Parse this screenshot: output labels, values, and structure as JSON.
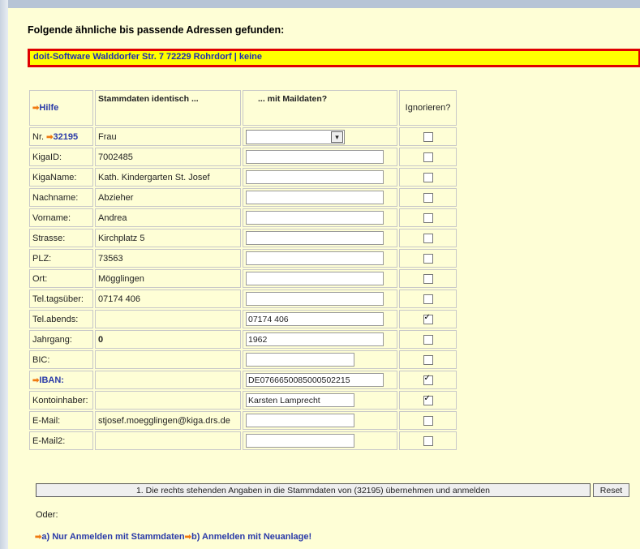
{
  "heading": "Folgende ähnliche bis passende Adressen gefunden:",
  "banner": "doit-Software Walddorfer Str. 7 72229 Rohrdorf | keine",
  "table": {
    "help_link": "Hilfe",
    "col_master": "Stammdaten identisch ...",
    "col_mail": "... mit Maildaten?",
    "col_ignore": "Ignorieren?",
    "rows": [
      {
        "label": "Nr.",
        "label_link": "32195",
        "master": "Frau",
        "mail_type": "select",
        "mail_value": "",
        "ignore": false
      },
      {
        "label": "KigaID:",
        "master": "7002485",
        "mail_type": "text",
        "mail_value": "",
        "ignore": false
      },
      {
        "label": "KigaName:",
        "master": "Kath. Kindergarten St. Josef",
        "mail_type": "text",
        "mail_value": "",
        "ignore": false
      },
      {
        "label": "Nachname:",
        "master": "Abzieher",
        "mail_type": "text",
        "mail_value": "",
        "ignore": false
      },
      {
        "label": "Vorname:",
        "master": "Andrea",
        "mail_type": "text",
        "mail_value": "",
        "ignore": false
      },
      {
        "label": "Strasse:",
        "master": "Kirchplatz 5",
        "mail_type": "text",
        "mail_value": "",
        "ignore": false
      },
      {
        "label": "PLZ:",
        "master": "73563",
        "mail_type": "text",
        "mail_value": "",
        "ignore": false
      },
      {
        "label": "Ort:",
        "master": "Mögglingen",
        "mail_type": "text",
        "mail_value": "",
        "ignore": false
      },
      {
        "label": "Tel.tagsüber:",
        "master": "07174 406",
        "mail_type": "text",
        "mail_value": "",
        "ignore": false
      },
      {
        "label": "Tel.abends:",
        "master": "",
        "mail_type": "text",
        "mail_value": "07174 406",
        "ignore": true
      },
      {
        "label": "Jahrgang:",
        "master": "0",
        "master_bold": true,
        "mail_type": "text",
        "mail_value": "1962",
        "ignore": false
      },
      {
        "label": "BIC:",
        "master": "",
        "mail_type": "textshort",
        "mail_value": "",
        "ignore": false
      },
      {
        "label": "IBAN:",
        "label_is_link": true,
        "master": "",
        "mail_type": "text",
        "mail_value": "DE0766650085000502215",
        "ignore": true
      },
      {
        "label": "Kontoinhaber:",
        "master": "",
        "mail_type": "textshort",
        "mail_value": "Karsten Lamprecht",
        "ignore": true
      },
      {
        "label": "E-Mail:",
        "master": "stjosef.moegglingen@kiga.drs.de",
        "mail_type": "textshort",
        "mail_value": "",
        "ignore": false
      },
      {
        "label": "E-Mail2:",
        "master": "",
        "mail_type": "textshort",
        "mail_value": "",
        "ignore": false
      }
    ]
  },
  "submit_label": "1. Die rechts stehenden Angaben in die Stammdaten von (32195) übernehmen und anmelden",
  "reset_label": "Reset",
  "oder": "Oder:",
  "link_a": "a) Nur Anmelden mit Stammdaten",
  "link_b": "b) Anmelden mit Neuanlage!",
  "colors": {
    "page_bg": "#fefed6",
    "banner_bg": "#ffff00",
    "banner_border": "#e00000",
    "link": "#2a3aa8",
    "arrow": "#f07a10"
  }
}
